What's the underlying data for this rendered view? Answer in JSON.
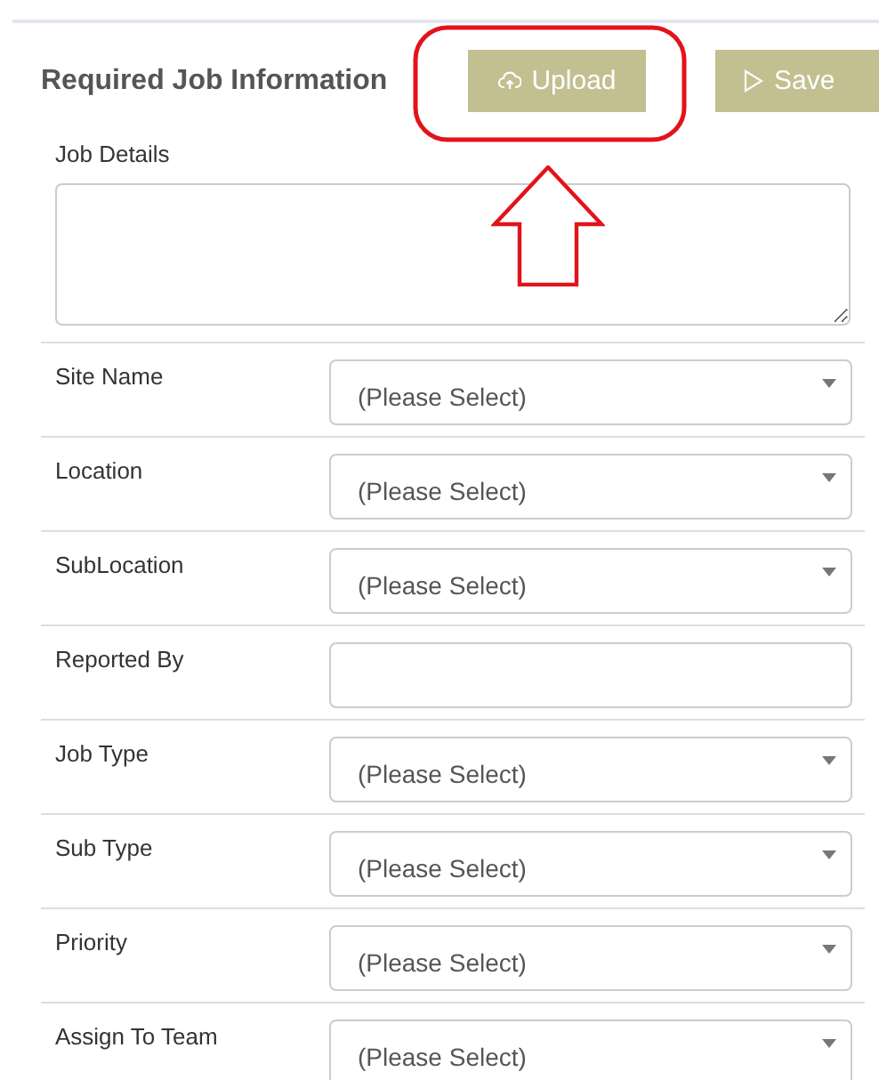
{
  "header": {
    "title": "Required Job Information"
  },
  "buttons": [
    {
      "label": "Upload",
      "kind": "upload"
    },
    {
      "label": "Save",
      "kind": "save"
    }
  ],
  "job_details": {
    "label": "Job Details"
  },
  "fields": [
    {
      "label": "Site Name",
      "kind": "select",
      "value": "(Please Select)"
    },
    {
      "label": "Location",
      "kind": "select",
      "value": "(Please Select)"
    },
    {
      "label": "SubLocation",
      "kind": "select",
      "value": "(Please Select)"
    },
    {
      "label": "Reported By",
      "kind": "text"
    },
    {
      "label": "Job Type",
      "kind": "select",
      "value": "(Please Select)"
    },
    {
      "label": "Sub Type",
      "kind": "select",
      "value": "(Please Select)"
    },
    {
      "label": "Priority",
      "kind": "select",
      "value": "(Please Select)"
    },
    {
      "label": "Assign To Team",
      "kind": "select",
      "value": "(Please Select)"
    }
  ]
}
